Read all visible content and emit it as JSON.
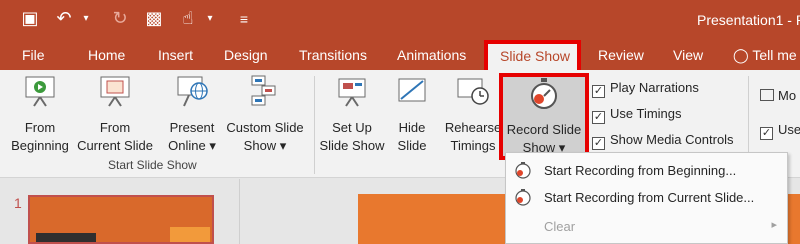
{
  "titlebar": {
    "title": "Presentation1 - P",
    "qat": [
      {
        "name": "save-icon",
        "glyph": "🖫"
      },
      {
        "name": "undo-icon",
        "glyph": "↶"
      },
      {
        "name": "redo-icon",
        "glyph": "↻"
      },
      {
        "name": "start-from-beginning-icon",
        "glyph": "▣"
      },
      {
        "name": "touch-mode-icon",
        "glyph": "☝"
      },
      {
        "name": "customize-qat-icon",
        "glyph": "="
      }
    ]
  },
  "tabs": {
    "file": "File",
    "home": "Home",
    "insert": "Insert",
    "design": "Design",
    "transitions": "Transitions",
    "animations": "Animations",
    "slide_show": "Slide Show",
    "review": "Review",
    "view": "View",
    "tell_me": "Tell me"
  },
  "ribbon": {
    "start_group": {
      "label": "Start Slide Show",
      "from_beginning": [
        "From",
        "Beginning"
      ],
      "from_current": [
        "From",
        "Current Slide"
      ],
      "present_online": [
        "Present",
        "Online ▾"
      ],
      "custom_show": [
        "Custom Slide",
        "Show ▾"
      ]
    },
    "setup_group": {
      "setup": [
        "Set Up",
        "Slide Show"
      ],
      "hide": [
        "Hide",
        "Slide"
      ],
      "rehearse": [
        "Rehearse",
        "Timings"
      ],
      "record": [
        "Record Slide",
        "Show ▾"
      ],
      "play_narrations": "Play Narrations",
      "use_timings": "Use Timings",
      "show_media_controls": "Show Media Controls"
    },
    "monitors_group": {
      "monitor_label": "Mo",
      "use_label": "Use"
    }
  },
  "slides": {
    "number": "1"
  },
  "menu": {
    "start_beginning": "Start Recording from Beginning...",
    "start_current": "Start Recording from Current Slide...",
    "clear": "Clear"
  },
  "colors": {
    "accent": "#b7472a",
    "highlight": "#e60000"
  }
}
